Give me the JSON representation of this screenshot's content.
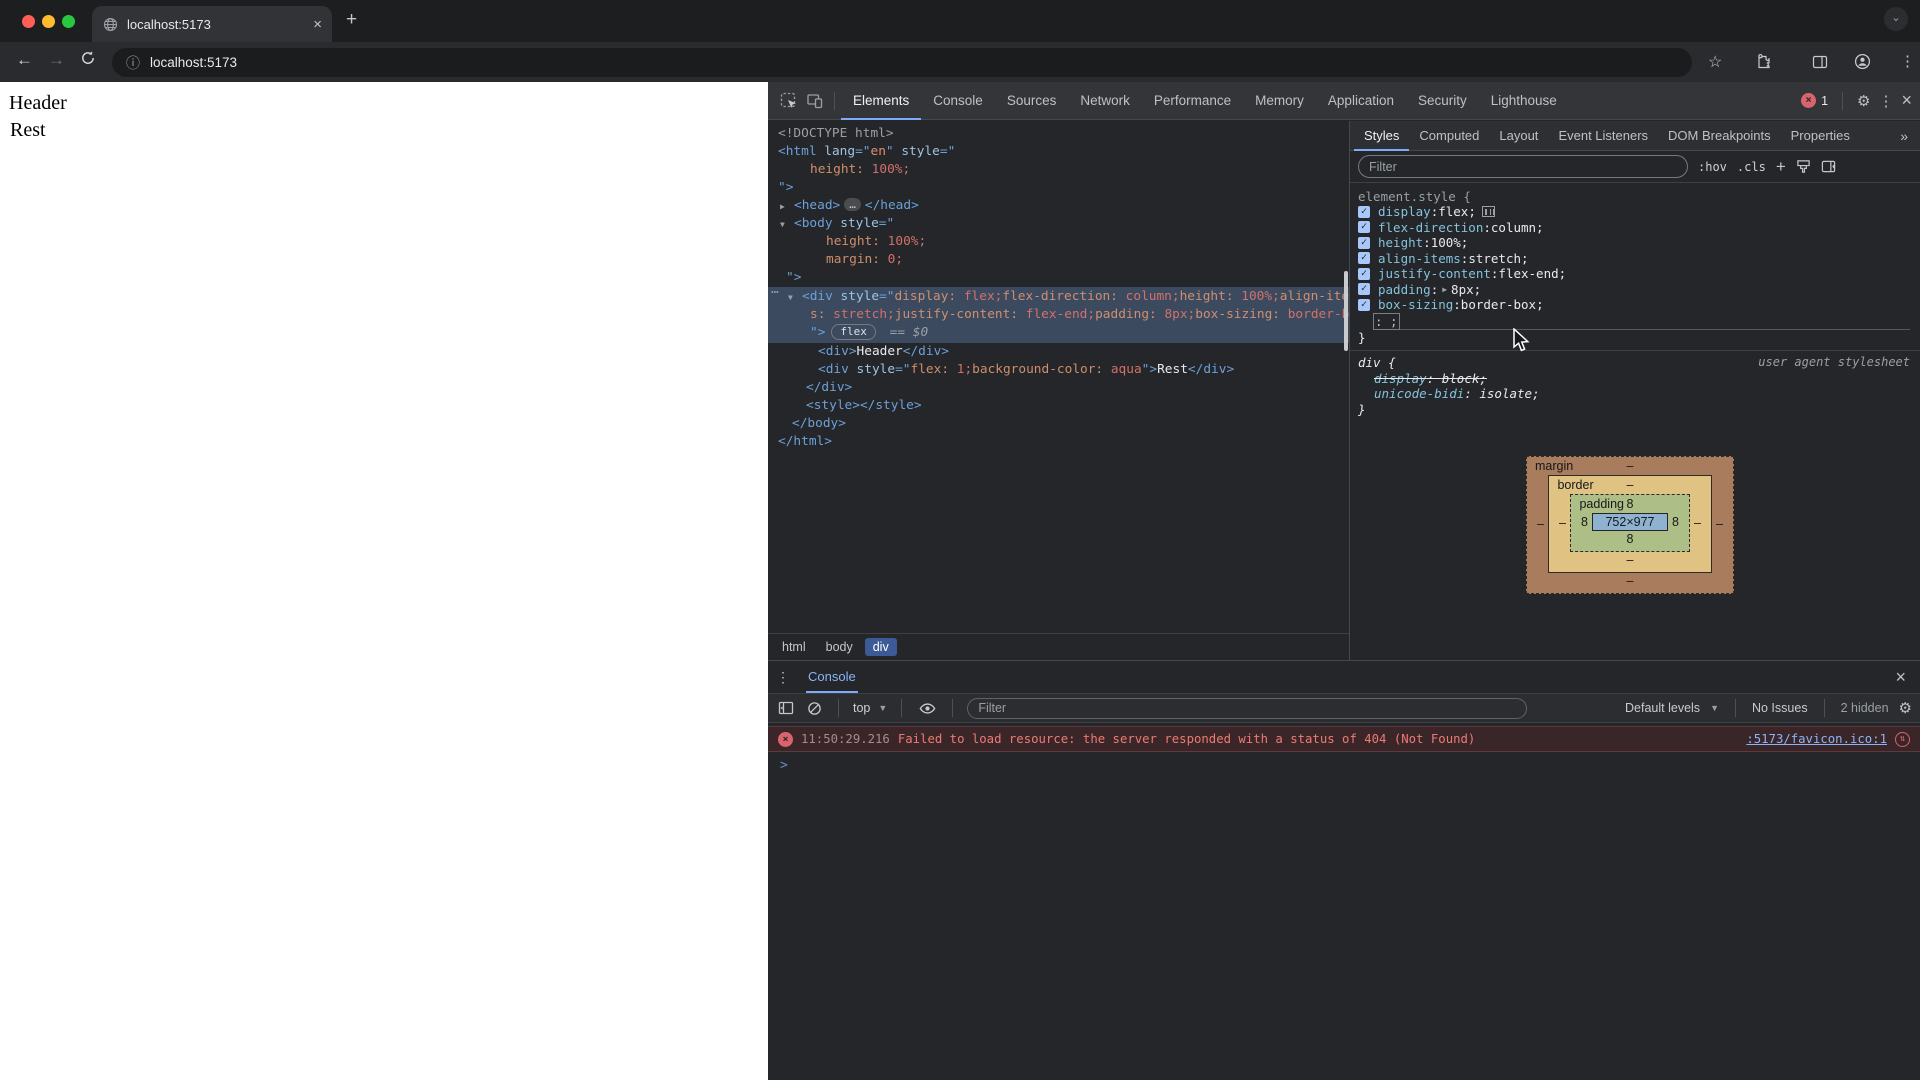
{
  "browser": {
    "tab": {
      "title": "localhost:5173",
      "close_glyph": "×",
      "new_tab_glyph": "+"
    },
    "address": {
      "url": "localhost:5173",
      "back_glyph": "←",
      "forward_glyph": "→",
      "info_glyph": "ⓘ",
      "star_glyph": "☆",
      "menu_glyph": "⋮",
      "tab_search_glyph": "⌄"
    }
  },
  "page": {
    "header_text": "Header",
    "rest_text": "Rest",
    "aqua_color": "#00ffff"
  },
  "devtools": {
    "tabs": [
      "Elements",
      "Console",
      "Sources",
      "Network",
      "Performance",
      "Memory",
      "Application",
      "Security",
      "Lighthouse"
    ],
    "selected_tab": "Elements",
    "error_badge_count": "1",
    "glyphs": {
      "gear": "⚙",
      "kebab": "⋮",
      "close": "×",
      "more_tabs": "»"
    },
    "elements": {
      "tree": [
        {
          "indent": 10,
          "segs": [
            [
              "gray",
              "<!DOCTYPE html>"
            ]
          ]
        },
        {
          "indent": 10,
          "segs": [
            [
              "tag",
              "<html"
            ],
            [
              "plain",
              " "
            ],
            [
              "attr",
              "lang"
            ],
            [
              "q",
              "=\""
            ],
            [
              "str",
              "en"
            ],
            [
              "q",
              "\" "
            ],
            [
              "attr",
              "style"
            ],
            [
              "q",
              "=\""
            ]
          ]
        },
        {
          "indent": 42,
          "segs": [
            [
              "prop",
              "height:"
            ],
            [
              "plain",
              " "
            ],
            [
              "val",
              "100%;"
            ]
          ]
        },
        {
          "indent": 10,
          "segs": [
            [
              "q",
              "\">"
            ]
          ]
        },
        {
          "indent": 26,
          "arrow": "▶",
          "segs": [
            [
              "tag",
              "<head>"
            ],
            [
              "dots",
              "…"
            ],
            [
              "tag",
              "</head>"
            ]
          ]
        },
        {
          "indent": 26,
          "arrow": "▼",
          "segs": [
            [
              "tag",
              "<body"
            ],
            [
              "plain",
              " "
            ],
            [
              "attr",
              "style"
            ],
            [
              "q",
              "=\""
            ]
          ]
        },
        {
          "indent": 58,
          "segs": [
            [
              "prop",
              "height:"
            ],
            [
              "plain",
              " "
            ],
            [
              "val",
              "100%;"
            ]
          ]
        },
        {
          "indent": 58,
          "segs": [
            [
              "prop",
              "margin:"
            ],
            [
              "plain",
              " "
            ],
            [
              "val",
              "0;"
            ]
          ]
        },
        {
          "indent": 18,
          "segs": [
            [
              "q",
              "\">"
            ]
          ]
        },
        {
          "selected": true,
          "gutter": "⋯",
          "arrow": "▼",
          "lines": [
            {
              "indent": 34,
              "segs": [
                [
                  "tag",
                  "<div"
                ],
                [
                  "plain",
                  " "
                ],
                [
                  "attr",
                  "style"
                ],
                [
                  "q",
                  "=\""
                ],
                [
                  "prop",
                  "display:"
                ],
                [
                  "val",
                  " flex;"
                ],
                [
                  "prop",
                  "flex-direction:"
                ],
                [
                  "val",
                  " column;"
                ],
                [
                  "prop",
                  "height:"
                ],
                [
                  "val",
                  " 100%;"
                ],
                [
                  "prop",
                  "align-item"
                ]
              ]
            },
            {
              "indent": 42,
              "segs": [
                [
                  "prop",
                  "s:"
                ],
                [
                  "val",
                  " stretch;"
                ],
                [
                  "prop",
                  "justify-content:"
                ],
                [
                  "val",
                  " flex-end;"
                ],
                [
                  "prop",
                  "padding:"
                ],
                [
                  "val",
                  " 8px;"
                ],
                [
                  "prop",
                  "box-sizing:"
                ],
                [
                  "val",
                  " border-box;"
                ]
              ]
            },
            {
              "indent": 42,
              "segs": [
                [
                  "q",
                  "\">"
                ],
                [
                  "badge",
                  "flex"
                ],
                [
                  "eq",
                  " == $0"
                ]
              ]
            }
          ]
        },
        {
          "indent": 50,
          "segs": [
            [
              "tag",
              "<div>"
            ],
            [
              "plain",
              "Header"
            ],
            [
              "tag",
              "</div>"
            ]
          ]
        },
        {
          "indent": 50,
          "segs": [
            [
              "tag",
              "<div"
            ],
            [
              "plain",
              " "
            ],
            [
              "attr",
              "style"
            ],
            [
              "q",
              "=\""
            ],
            [
              "prop",
              "flex:"
            ],
            [
              "val",
              " 1;"
            ],
            [
              "prop",
              "background-color:"
            ],
            [
              "val",
              " aqua"
            ],
            [
              "q",
              "\">"
            ],
            [
              "plain",
              "Rest"
            ],
            [
              "tag",
              "</div>"
            ]
          ]
        },
        {
          "indent": 38,
          "segs": [
            [
              "tag",
              "</div>"
            ]
          ]
        },
        {
          "indent": 38,
          "segs": [
            [
              "tag",
              "<style>"
            ],
            [
              "tag",
              "</style>"
            ]
          ]
        },
        {
          "indent": 24,
          "segs": [
            [
              "tag",
              "</body>"
            ]
          ]
        },
        {
          "indent": 10,
          "segs": [
            [
              "tag",
              "</html>"
            ]
          ]
        }
      ],
      "breadcrumbs": [
        {
          "label": "html",
          "selected": false
        },
        {
          "label": "body",
          "selected": false
        },
        {
          "label": "div",
          "selected": true
        }
      ]
    },
    "styles": {
      "tabs": [
        "Styles",
        "Computed",
        "Layout",
        "Event Listeners",
        "DOM Breakpoints",
        "Properties"
      ],
      "selected_tab": "Styles",
      "filter_placeholder": "Filter",
      "hov_label": ":hov",
      "cls_label": ".cls",
      "add_label": "+",
      "element_style": {
        "selector": "element.style",
        "open_brace": " {",
        "properties": [
          {
            "name": "display",
            "value": "flex",
            "flex_icon": true
          },
          {
            "name": "flex-direction",
            "value": "column"
          },
          {
            "name": "height",
            "value": "100%"
          },
          {
            "name": "align-items",
            "value": "stretch"
          },
          {
            "name": "justify-content",
            "value": "flex-end"
          },
          {
            "name": "padding",
            "value": "8px",
            "expandable": true
          },
          {
            "name": "box-sizing",
            "value": "border-box"
          }
        ],
        "new_property": ": ;",
        "close_brace": "}"
      },
      "ua_rule": {
        "selector": "div {",
        "origin": "user agent stylesheet",
        "properties": [
          {
            "name": "display",
            "value": "block",
            "struck": true
          },
          {
            "name": "unicode-bidi",
            "value": "isolate",
            "struck": false
          }
        ],
        "close_brace": "}"
      },
      "box_model": {
        "margin_label": "margin",
        "border_label": "border",
        "padding_label": "padding",
        "content": "752×977",
        "margin": {
          "top": "–",
          "right": "–",
          "bottom": "–",
          "left": "–"
        },
        "border": {
          "top": "–",
          "right": "–",
          "bottom": "–",
          "left": "–"
        },
        "padding": {
          "top": "8",
          "right": "8",
          "bottom": "8",
          "left": "8"
        }
      }
    }
  },
  "console": {
    "tab_label": "Console",
    "kebab_glyph": "⋮",
    "close_glyph": "×",
    "context_label": "top",
    "filter_placeholder": "Filter",
    "default_levels_label": "Default levels",
    "no_issues_label": "No Issues",
    "hidden_label": "2 hidden",
    "gear_glyph": "⚙",
    "error": {
      "timestamp": "11:50:29.216",
      "message": "Failed to load resource: the server responded with a status of 404 (Not Found)",
      "source_link": ":5173/favicon.ico:1"
    },
    "prompt_glyph": ">"
  }
}
